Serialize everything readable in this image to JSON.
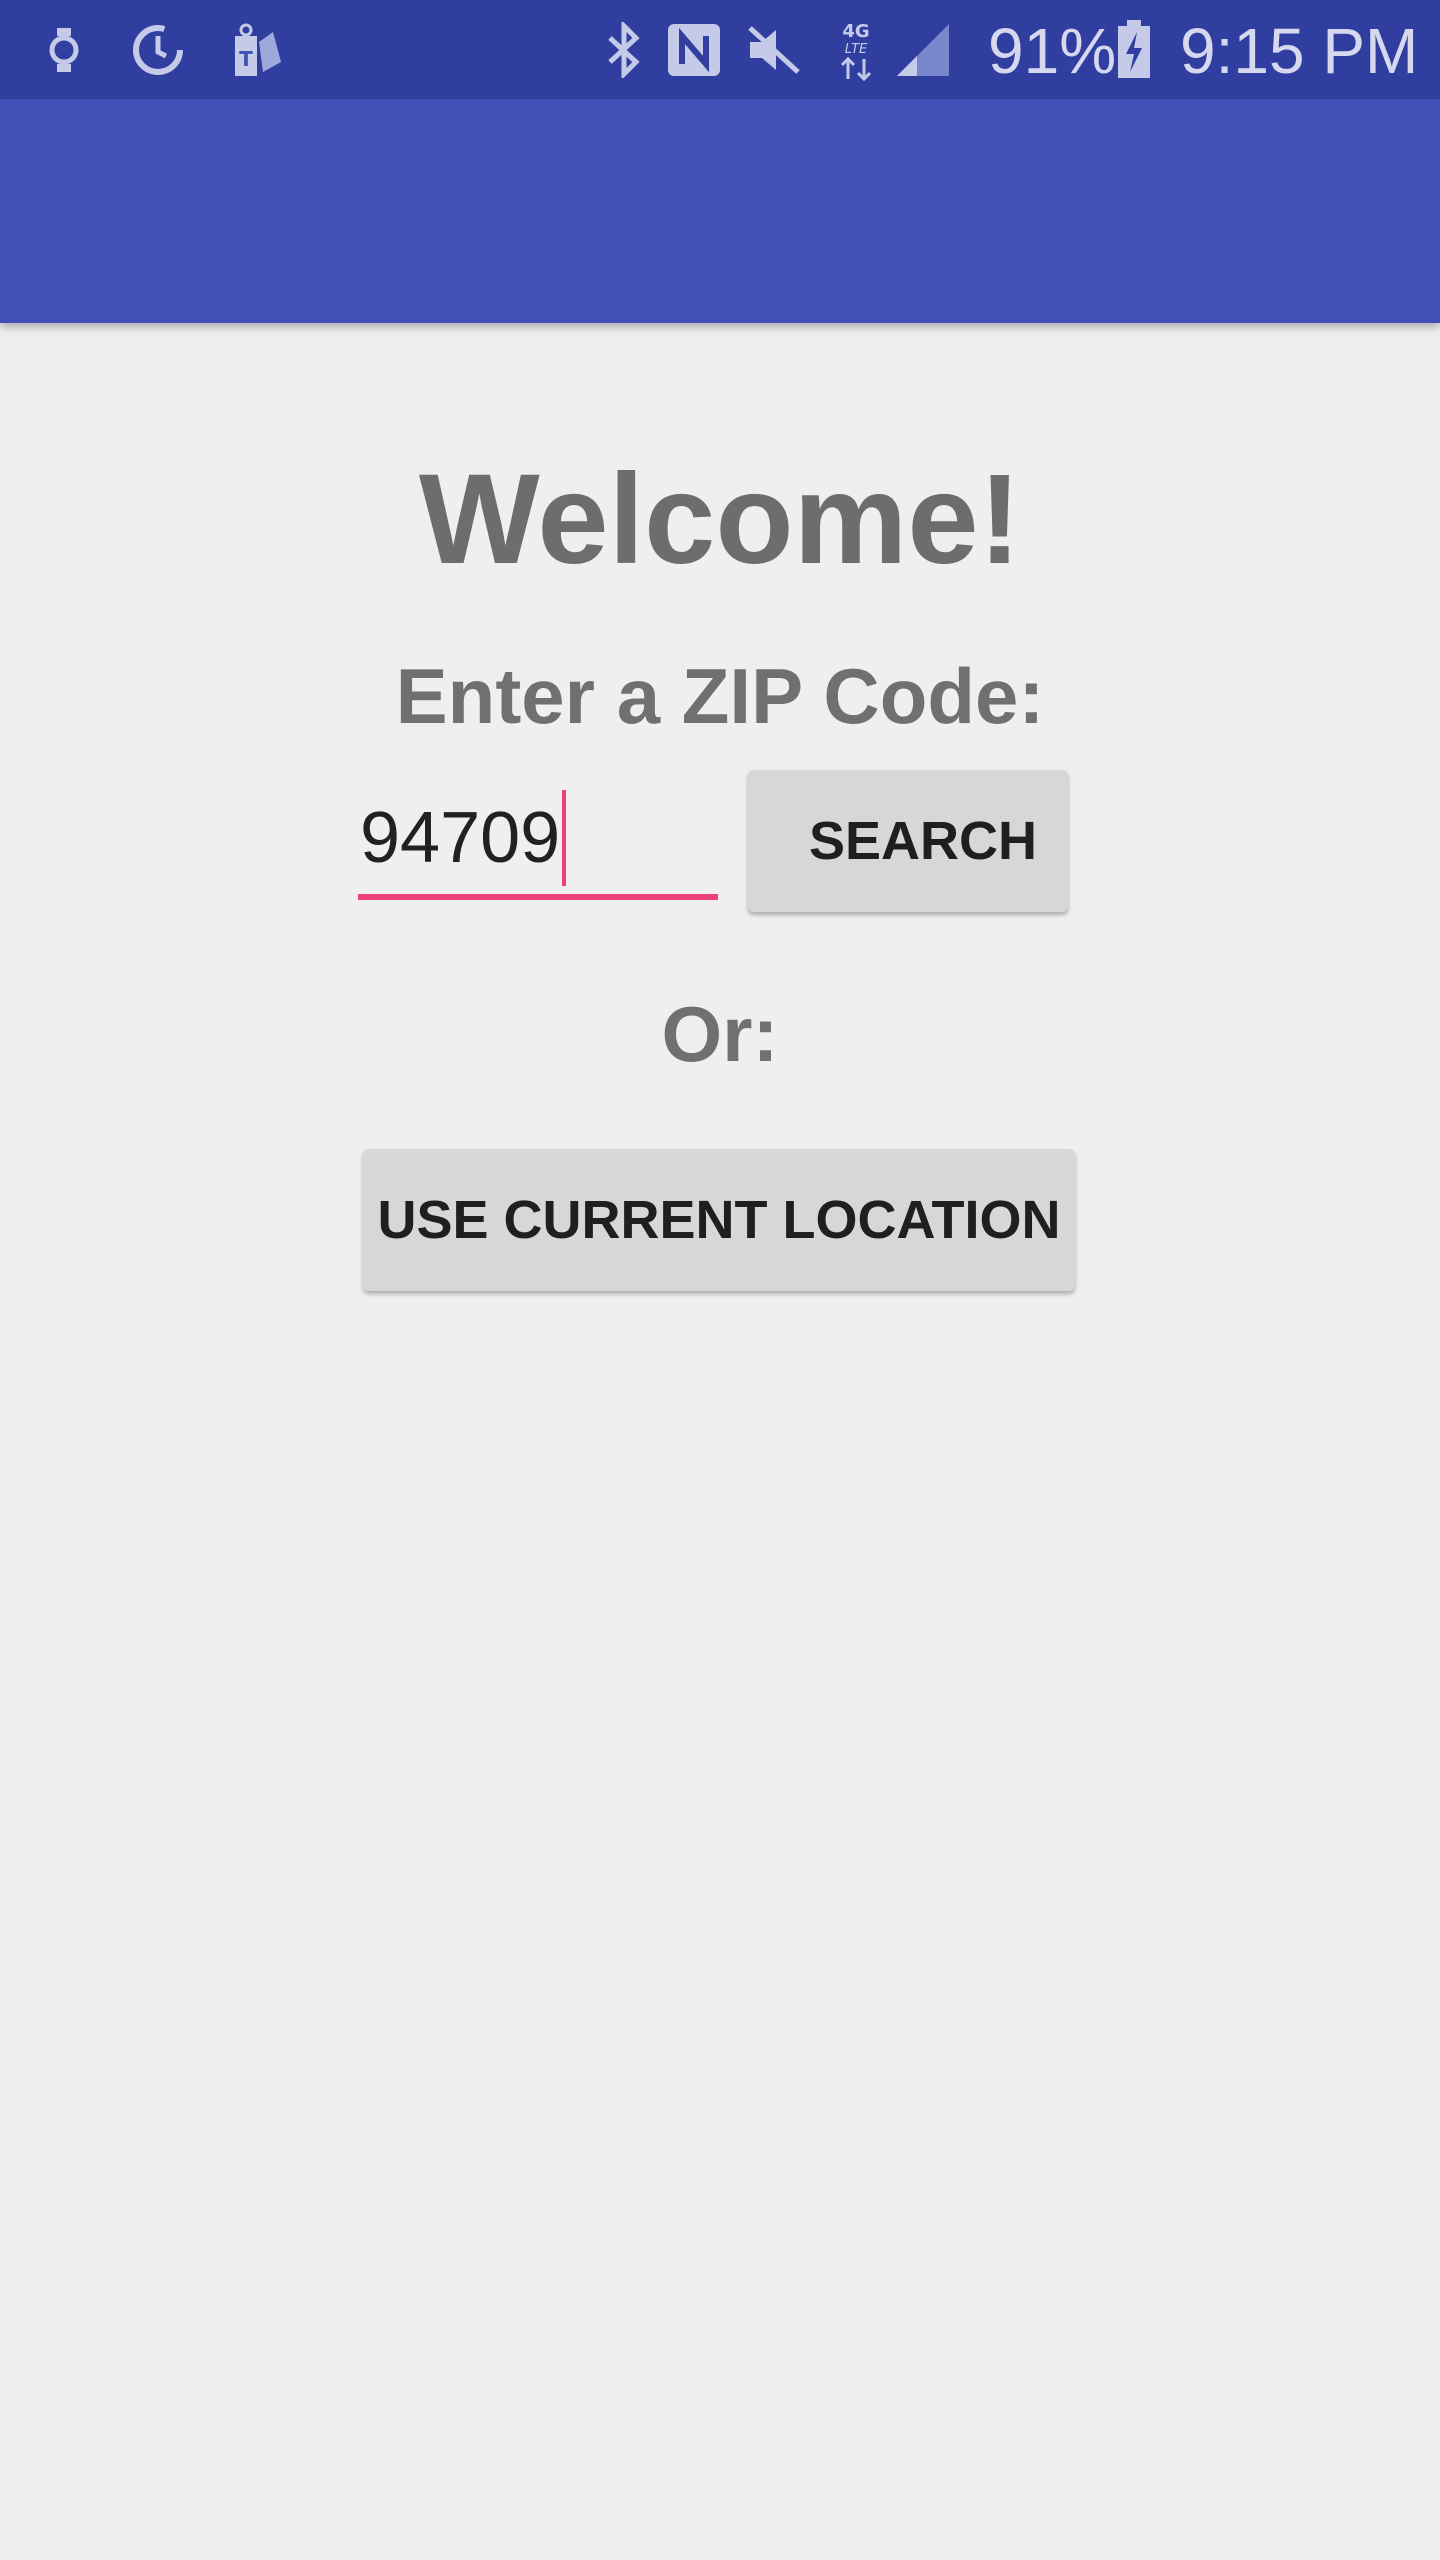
{
  "status_bar": {
    "icons": [
      "watch-icon",
      "sync-icon",
      "tmobile-icon",
      "bluetooth-icon",
      "nfc-icon",
      "mute-icon",
      "data-4g-lte-icon",
      "signal-icon",
      "battery-charging-icon"
    ],
    "battery_percent": "91%",
    "time": "9:15 PM"
  },
  "colors": {
    "status_bar": "#303f9f",
    "app_bar": "#3f51b5",
    "background": "#efefef",
    "accent": "#ec407a",
    "button": "#d6d7d7"
  },
  "main": {
    "welcome": "Welcome!",
    "zip_label": "Enter a ZIP Code:",
    "zip_value": "94709",
    "search_label": "SEARCH",
    "or_label": "Or:",
    "location_label": "USE CURRENT LOCATION"
  }
}
